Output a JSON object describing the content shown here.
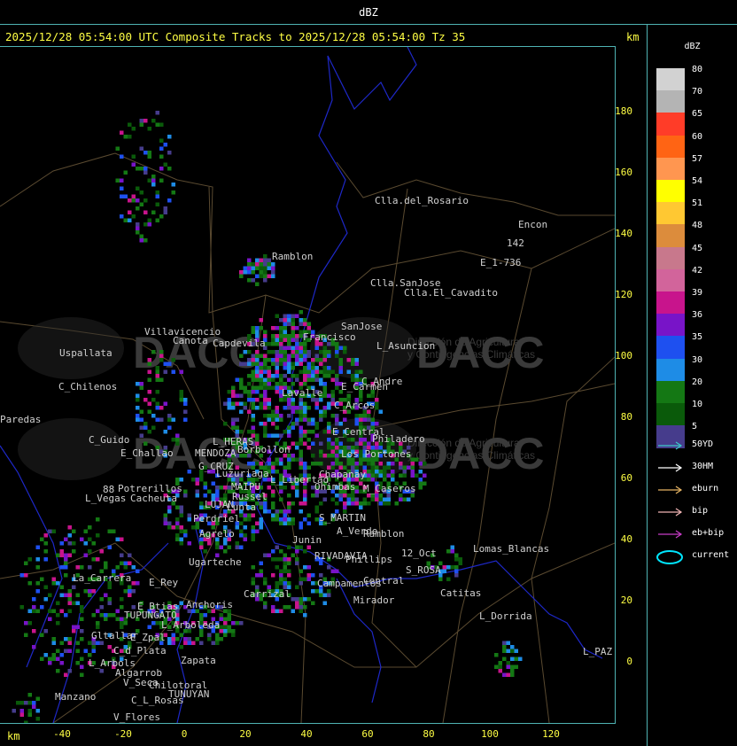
{
  "header": {
    "title": "dBZ"
  },
  "map_header": {
    "subtitle": "2025/12/28 05:54:00 UTC Composite Tracks to 2025/12/28 05:54:00 Tz 35",
    "km_label": "km"
  },
  "axes": {
    "y_ticks": [
      "180",
      "160",
      "140",
      "120",
      "100",
      "80",
      "60",
      "40",
      "20",
      "0"
    ],
    "x_ticks": [
      "-40",
      "-20",
      "0",
      "20",
      "40",
      "60",
      "80",
      "100",
      "120"
    ],
    "x_unit": "km"
  },
  "legend": {
    "unit": "dBZ",
    "levels": [
      {
        "label": "80",
        "color": "#d2d2d2"
      },
      {
        "label": "70",
        "color": "#b4b4b4"
      },
      {
        "label": "65",
        "color": "#ff3c28"
      },
      {
        "label": "60",
        "color": "#ff6414"
      },
      {
        "label": "57",
        "color": "#ff9650"
      },
      {
        "label": "54",
        "color": "#ffff00"
      },
      {
        "label": "51",
        "color": "#ffc832"
      },
      {
        "label": "48",
        "color": "#dc8c3c"
      },
      {
        "label": "45",
        "color": "#c8788c"
      },
      {
        "label": "42",
        "color": "#d2649b"
      },
      {
        "label": "39",
        "color": "#c8148c"
      },
      {
        "label": "36",
        "color": "#7814c8"
      },
      {
        "label": "35",
        "color": "#1e50f0"
      },
      {
        "label": "30",
        "color": "#1e8ce6"
      },
      {
        "label": "20",
        "color": "#147814"
      },
      {
        "label": "10",
        "color": "#0a5a0a"
      },
      {
        "label": "5",
        "color": "#463c8c"
      }
    ],
    "tracks": [
      {
        "label": "50YD",
        "color": "#3cc8c8"
      },
      {
        "label": "30HM",
        "color": "#ffffff"
      },
      {
        "label": "eburn",
        "color": "#e6b464"
      },
      {
        "label": "bip",
        "color": "#f0b4b4"
      },
      {
        "label": "eb+bip",
        "color": "#c83cc8"
      },
      {
        "label": "current",
        "color": "#00e6ff"
      }
    ]
  },
  "watermark": {
    "text": "DACC",
    "subtext_1": "Dirección de Agricultura",
    "subtext_2": "y Contingencias Climáticas"
  },
  "places": [
    {
      "name": "Clla.del_Rosario"
    },
    {
      "name": "Encon"
    },
    {
      "name": "142"
    },
    {
      "name": "E_1-736"
    },
    {
      "name": "Ramblon"
    },
    {
      "name": "Clla.SanJose"
    },
    {
      "name": "Clla.El_Cavadito"
    },
    {
      "name": "Villavicencio"
    },
    {
      "name": "Canota"
    },
    {
      "name": "Capdevila"
    },
    {
      "name": "Francisco"
    },
    {
      "name": "SanJose"
    },
    {
      "name": "L_Asuncion"
    },
    {
      "name": "Uspallata"
    },
    {
      "name": "C_Chilenos"
    },
    {
      "name": "Lavalle"
    },
    {
      "name": "C_Andre"
    },
    {
      "name": "E_Carmen"
    },
    {
      "name": "C_Arcos"
    },
    {
      "name": "Paredas"
    },
    {
      "name": "C_Guido"
    },
    {
      "name": "E_Challao"
    },
    {
      "name": "L_HERAS"
    },
    {
      "name": "MENDOZA"
    },
    {
      "name": "G_CRUZ"
    },
    {
      "name": "Luzuriaga"
    },
    {
      "name": "Borbollon"
    },
    {
      "name": "E_Central"
    },
    {
      "name": "Los Portones"
    },
    {
      "name": "Philadero"
    },
    {
      "name": "L_Libertad"
    },
    {
      "name": "Chapanay"
    },
    {
      "name": "Potrerillos"
    },
    {
      "name": "L_Vegas"
    },
    {
      "name": "Cacheuta"
    },
    {
      "name": "MAIPU"
    },
    {
      "name": "Russel"
    },
    {
      "name": "LUJAN"
    },
    {
      "name": "Lunta"
    },
    {
      "name": "Perdriel"
    },
    {
      "name": "Ohimbas"
    },
    {
      "name": "M_Caseros"
    },
    {
      "name": "Agrelo"
    },
    {
      "name": "S_MARTIN"
    },
    {
      "name": "A_Verde"
    },
    {
      "name": "Ramblon"
    },
    {
      "name": "Junin"
    },
    {
      "name": "Lomas_Blancas"
    },
    {
      "name": "12_Oct"
    },
    {
      "name": "Phillips"
    },
    {
      "name": "Ugarteche"
    },
    {
      "name": "RIVADAVIA"
    },
    {
      "name": "La_Carrera"
    },
    {
      "name": "S_ROSA"
    },
    {
      "name": "Carrizal"
    },
    {
      "name": "Campamentos"
    },
    {
      "name": "Central"
    },
    {
      "name": "Catitas"
    },
    {
      "name": "Anchoris"
    },
    {
      "name": "Mirador"
    },
    {
      "name": "E_Rey"
    },
    {
      "name": "E_Btias"
    },
    {
      "name": "TUPUNGATO"
    },
    {
      "name": "L_Dorrida"
    },
    {
      "name": "L_Arboleda"
    },
    {
      "name": "Gltallar"
    },
    {
      "name": "E_Zpal"
    },
    {
      "name": "C_d_Plata"
    },
    {
      "name": "L_Arbols"
    },
    {
      "name": "Zapata"
    },
    {
      "name": "Algarrob"
    },
    {
      "name": "V_Seca"
    },
    {
      "name": "Chilotoral"
    },
    {
      "name": "TUNUYAN"
    },
    {
      "name": "Manzano"
    },
    {
      "name": "C_L_Rosas"
    },
    {
      "name": "V_Flores"
    },
    {
      "name": "L_PAZ"
    },
    {
      "name": "88"
    }
  ]
}
